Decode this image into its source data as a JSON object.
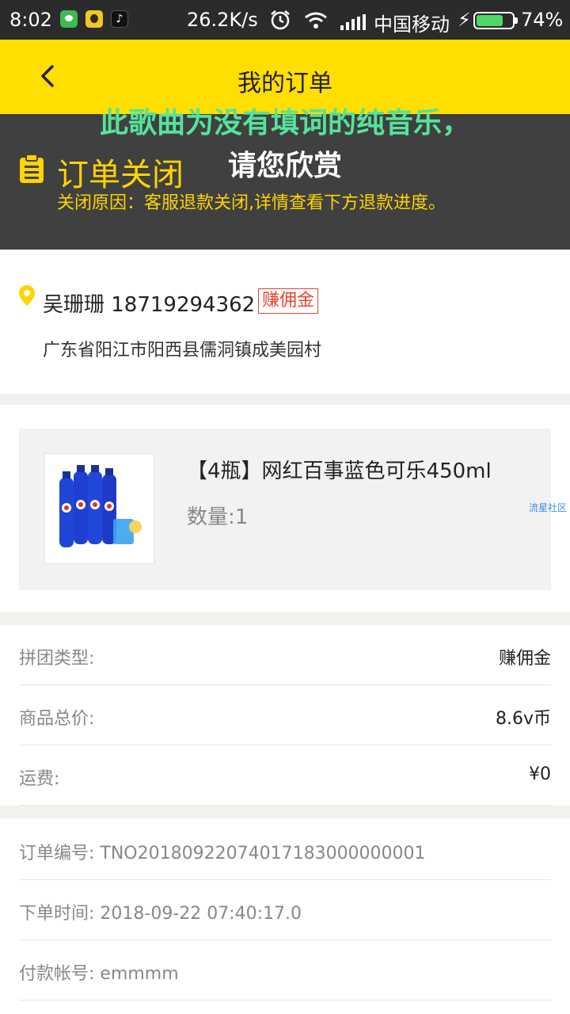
{
  "status_bar": {
    "time": "8:02",
    "speed": "26.2K/s",
    "carrier": "中国移动",
    "battery_pct": "74%",
    "battery_level": 0.74,
    "icons": [
      "wechat-icon",
      "fruit-app-icon",
      "tiktok-icon",
      "alarm-icon",
      "wifi-icon",
      "signal-icon",
      "charging-icon",
      "battery-icon"
    ]
  },
  "nav": {
    "title": "我的订单",
    "back_icon": "chevron-left-icon"
  },
  "order_status": {
    "title": "订单关闭",
    "reason": "关闭原因：客服退款关闭,详情查看下方退款进度。",
    "icon": "clipboard-icon",
    "accent": "#ffd400"
  },
  "overlay": {
    "line1": "此歌曲为没有填词的纯音乐，",
    "line2": "请您欣赏"
  },
  "address": {
    "name_phone": "吴珊珊 18719294362",
    "badge": "赚佣金",
    "line": "广东省阳江市阳西县儒洞镇成美园村",
    "icon": "location-pin-icon"
  },
  "product": {
    "name": "【4瓶】网红百事蓝色可乐450ml",
    "qty": "数量:1",
    "watermark": "流星社区"
  },
  "summary": [
    {
      "label": "拼团类型:",
      "value": "赚佣金"
    },
    {
      "label": "商品总价:",
      "value": "8.6v币"
    },
    {
      "label": "运费:",
      "value": "¥0"
    }
  ],
  "details": [
    {
      "text": "订单编号: TNO20180922074017183000000001"
    },
    {
      "text": "下单时间: 2018-09-22 07:40:17.0"
    },
    {
      "text": "付款帐号: emmmm"
    }
  ],
  "colors": {
    "nav": "#ffde00",
    "panel": "#404040",
    "badge": "#e0452b",
    "lyric": "#55e39b"
  }
}
